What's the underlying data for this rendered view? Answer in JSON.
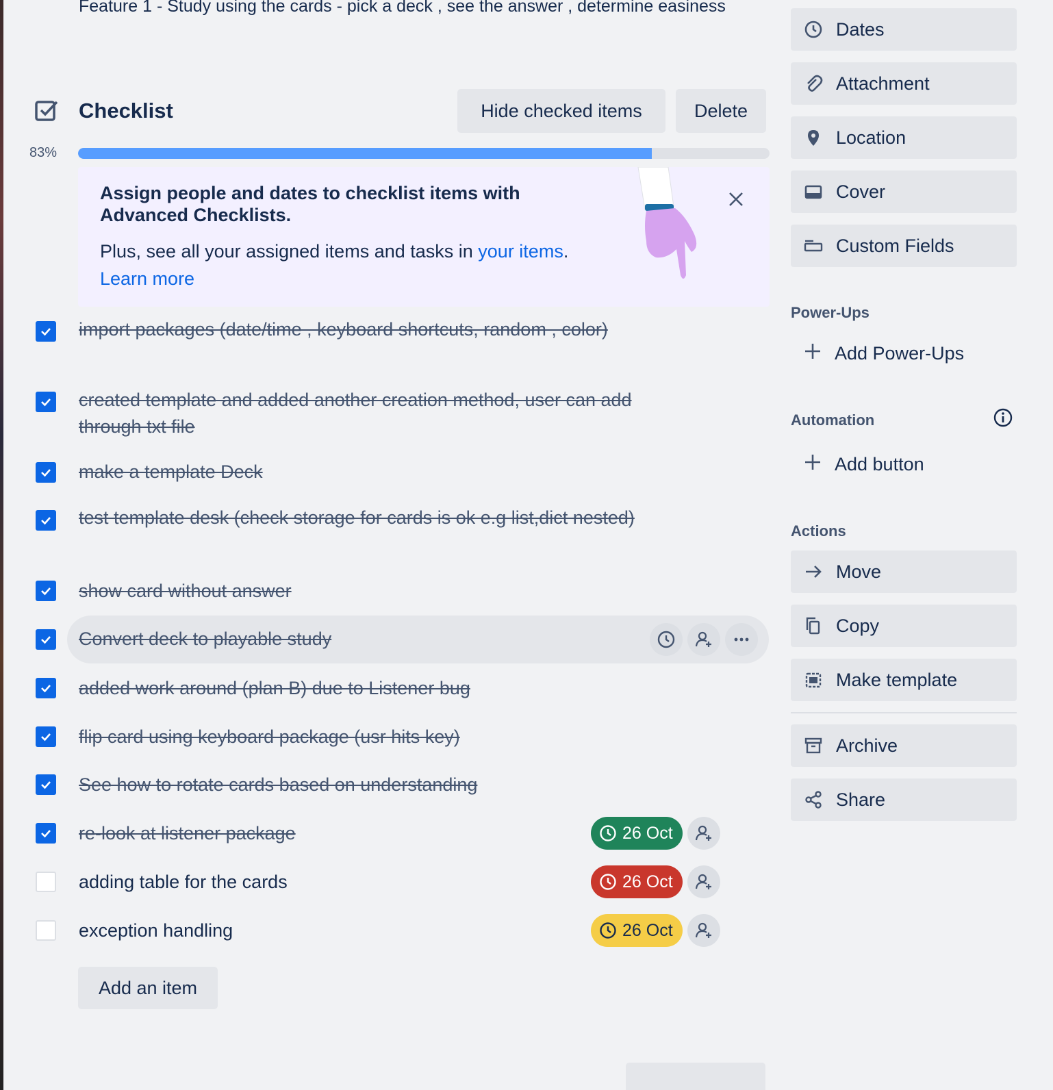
{
  "description": "Feature 1 - Study using the cards - pick a deck , see the answer , determine easiness",
  "checklist": {
    "title": "Checklist",
    "hide_checked_label": "Hide checked items",
    "delete_label": "Delete",
    "progress_label": "83%",
    "progress_fraction": 0.83,
    "promo": {
      "title": "Assign people and dates to checklist items with Advanced Checklists.",
      "body_prefix": "Plus, see all your assigned items and tasks in ",
      "body_link": "your items",
      "body_suffix": ".",
      "learn_more": "Learn more"
    },
    "items": [
      {
        "text": "import packages (date/time , keyboard shortcuts, random , color)",
        "checked": true
      },
      {
        "text": "created template and added another creation method, user can add through txt file",
        "checked": true
      },
      {
        "text": "make a template Deck",
        "checked": true
      },
      {
        "text": "test template desk (check storage for cards is ok e.g list,dict nested)",
        "checked": true
      },
      {
        "text": "show card without answer",
        "checked": true
      },
      {
        "text": "Convert deck to playable study",
        "checked": true
      },
      {
        "text": "added work around (plan B) due to Listener bug",
        "checked": true
      },
      {
        "text": "flip card using keyboard package (usr hits key)",
        "checked": true
      },
      {
        "text": "See how to rotate cards based on understanding",
        "checked": true
      },
      {
        "text": "re-look at listener package",
        "checked": true,
        "due": "26 Oct",
        "due_color": "#1f845a"
      },
      {
        "text": "adding table for the cards",
        "checked": false,
        "due": "26 Oct",
        "due_color": "#c9372c"
      },
      {
        "text": "exception handling",
        "checked": false,
        "due": "26 Oct",
        "due_color": "#f5cd47"
      }
    ],
    "add_item_label": "Add an item"
  },
  "sidebar": {
    "buttons": [
      {
        "label": "Dates",
        "icon": "clock-icon"
      },
      {
        "label": "Attachment",
        "icon": "paperclip-icon"
      },
      {
        "label": "Location",
        "icon": "location-pin-icon"
      },
      {
        "label": "Cover",
        "icon": "cover-icon"
      },
      {
        "label": "Custom Fields",
        "icon": "custom-fields-icon"
      }
    ],
    "powerups_label": "Power-Ups",
    "add_powerups": "Add Power-Ups",
    "automation_label": "Automation",
    "add_button": "Add button",
    "actions_label": "Actions",
    "actions": [
      {
        "label": "Move",
        "icon": "arrow-right-icon"
      },
      {
        "label": "Copy",
        "icon": "copy-icon"
      },
      {
        "label": "Make template",
        "icon": "template-icon"
      },
      {
        "label": "Archive",
        "icon": "archive-icon"
      },
      {
        "label": "Share",
        "icon": "share-icon"
      }
    ]
  },
  "colors": {
    "accent": "#0c66e4",
    "progress": "#579dff",
    "background": "#f1f2f4",
    "button": "#e4e6ea"
  }
}
